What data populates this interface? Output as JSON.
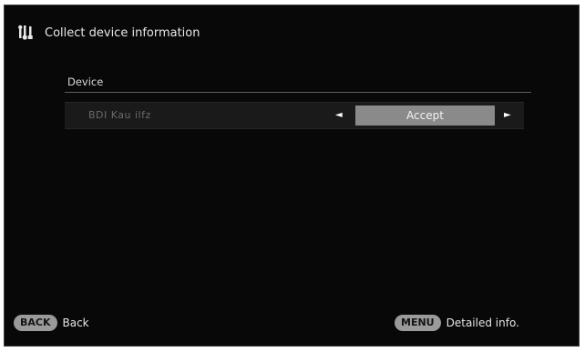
{
  "header": {
    "icon": "tools-icon",
    "title": "Collect device information"
  },
  "section": {
    "label": "Device"
  },
  "device_row": {
    "name": "BDI Kau ilfz",
    "value": "Accept",
    "left_arrow": "◄",
    "right_arrow": "►"
  },
  "footer": {
    "back_key": "BACK",
    "back_label": "Back",
    "menu_key": "MENU",
    "menu_label": "Detailed info."
  },
  "colors": {
    "background": "#080808",
    "selected_value": "#8a8a8a",
    "remote_key": "#9a9a9a",
    "text": "#e6e6e6"
  }
}
